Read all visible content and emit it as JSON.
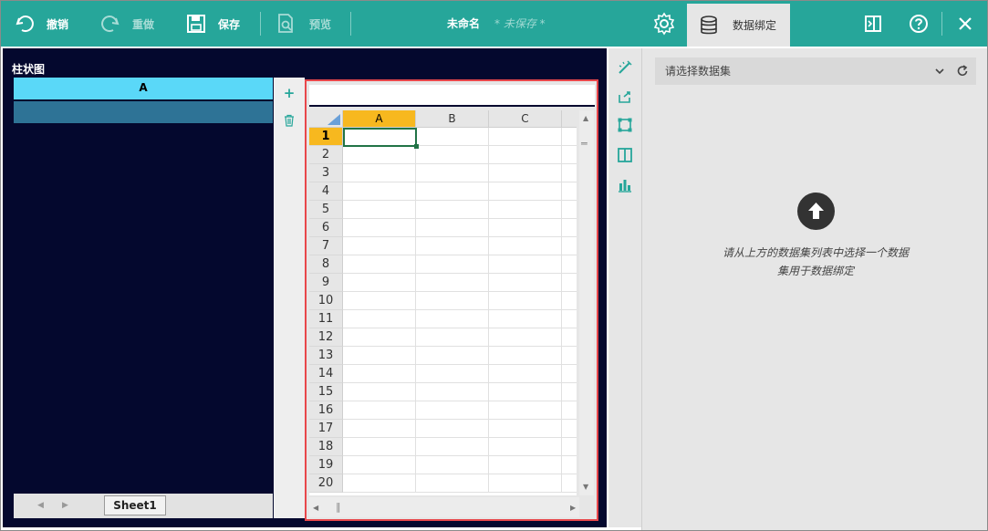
{
  "toolbar": {
    "undo_label": "撤销",
    "redo_label": "重做",
    "save_label": "保存",
    "preview_label": "预览",
    "doc_title": "未命名",
    "unsaved_label": "* 未保存 *",
    "data_binding_tab": "数据绑定"
  },
  "chart": {
    "title": "柱状图",
    "series_header": "A"
  },
  "sheet": {
    "columns": [
      "A",
      "B",
      "C"
    ],
    "rows": [
      "1",
      "2",
      "3",
      "4",
      "5",
      "6",
      "7",
      "8",
      "9",
      "10",
      "11",
      "12",
      "13",
      "14",
      "15",
      "16",
      "17",
      "18",
      "19",
      "20"
    ],
    "tab_name": "Sheet1"
  },
  "right_panel": {
    "dataset_placeholder": "请选择数据集",
    "hint_line1": "请从上方的数据集列表中选择一个数据",
    "hint_line2": "集用于数据绑定"
  },
  "colors": {
    "toolbar": "#26a69a",
    "chart_bg": "#04082e",
    "series_head": "#5ad8f8",
    "series_bar": "#2e7396",
    "selected_header": "#f7b81f",
    "highlight_border": "#e8474b"
  }
}
